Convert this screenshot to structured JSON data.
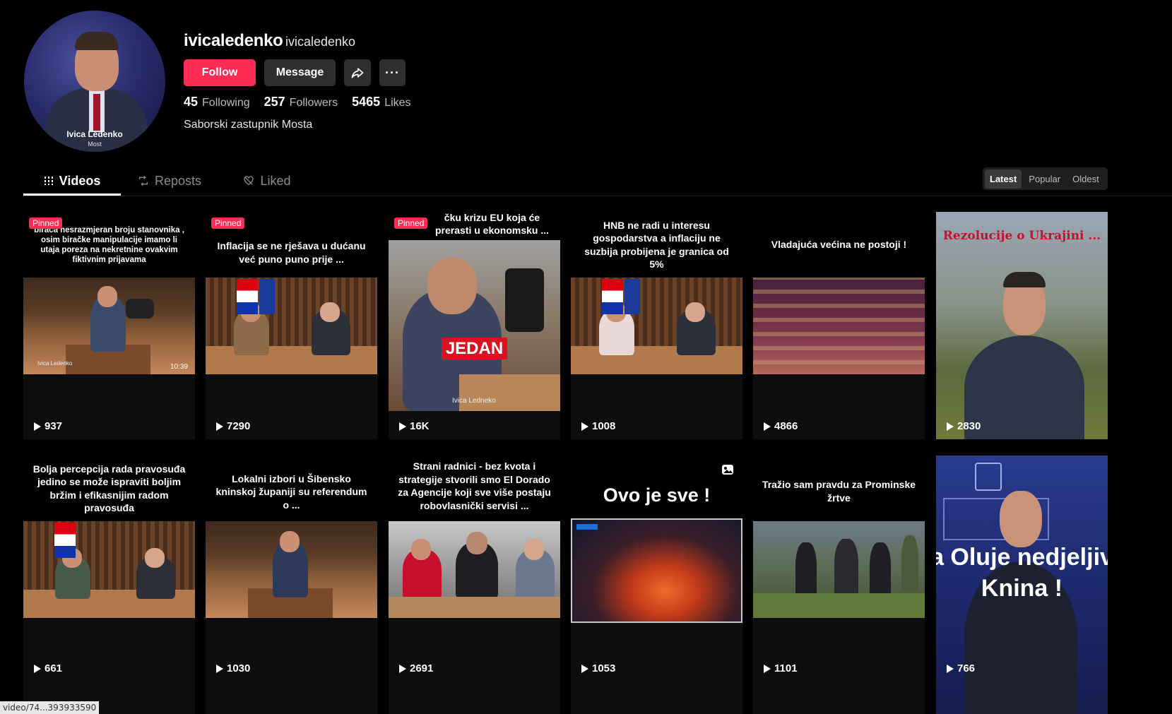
{
  "profile": {
    "username": "ivicaledenko",
    "nickname": "ivicaledenko",
    "avatar_name": "Ivica Ledenko",
    "avatar_sub": "Most",
    "bio": "Saborski zastupnik Mosta",
    "follow_label": "Follow",
    "message_label": "Message",
    "more_label": "···",
    "stats": [
      {
        "value": "45",
        "label": "Following"
      },
      {
        "value": "257",
        "label": "Followers"
      },
      {
        "value": "5465",
        "label": "Likes"
      }
    ]
  },
  "tabs": [
    {
      "label": "Videos",
      "icon": "grid-icon",
      "active": true
    },
    {
      "label": "Reposts",
      "icon": "repost-icon",
      "active": false
    },
    {
      "label": "Liked",
      "icon": "heart-icon",
      "active": false
    }
  ],
  "sort": [
    "Latest",
    "Popular",
    "Oldest"
  ],
  "pinned_label": "Pinned",
  "videos": [
    {
      "caption": "birača nesrazmjeran broju stanovnika , osim biračke manipulacije imamo li utaja poreza na nekretnine ovakvim fiktivnim prijavama",
      "views": "937",
      "pinned": true,
      "duration": "10:39",
      "lower_name": "Ivica Ledenko"
    },
    {
      "caption": "Inflacija se ne rješava u dućanu već puno puno prije ...",
      "views": "7290",
      "pinned": true
    },
    {
      "caption": "čku krizu EU koja će prerasti u ekonomsku ...",
      "views": "16K",
      "pinned": true,
      "overlay": "JEDAN",
      "lower_name": "Ivica Ledneko"
    },
    {
      "caption": "HNB ne radi u interesu gospodarstva a inflaciju ne suzbija probijena je granica od 5%",
      "views": "1008"
    },
    {
      "caption": "Vladajuća većina ne postoji !",
      "views": "4866"
    },
    {
      "caption": "Rezolucije o Ukrajini ...",
      "views": "2830"
    },
    {
      "caption": "Bolja percepcija rada pravosuđa jedino se može ispraviti boljim bržim i efikasnijim radom pravosuđa",
      "views": "661"
    },
    {
      "caption": "Lokalni izbori u Šibensko kninskoj županiji su referendum o ...",
      "views": "1030"
    },
    {
      "caption": "Strani radnici - bez kvota i strategije stvorili smo El Dorado za Agencije koji sve više postaju robovlasnički servisi ...",
      "views": "2691"
    },
    {
      "caption": "Ovo je sve !",
      "views": "1053"
    },
    {
      "caption": "Tražio sam pravdu za Prominske žrtve",
      "views": "1101"
    },
    {
      "caption": "a Oluje nedjeljiv Knina !",
      "views": "766"
    }
  ],
  "status_url": "video/74...393933590",
  "colors": {
    "accent": "#fe2c55",
    "background": "#000000",
    "button": "#2f2f2f"
  }
}
